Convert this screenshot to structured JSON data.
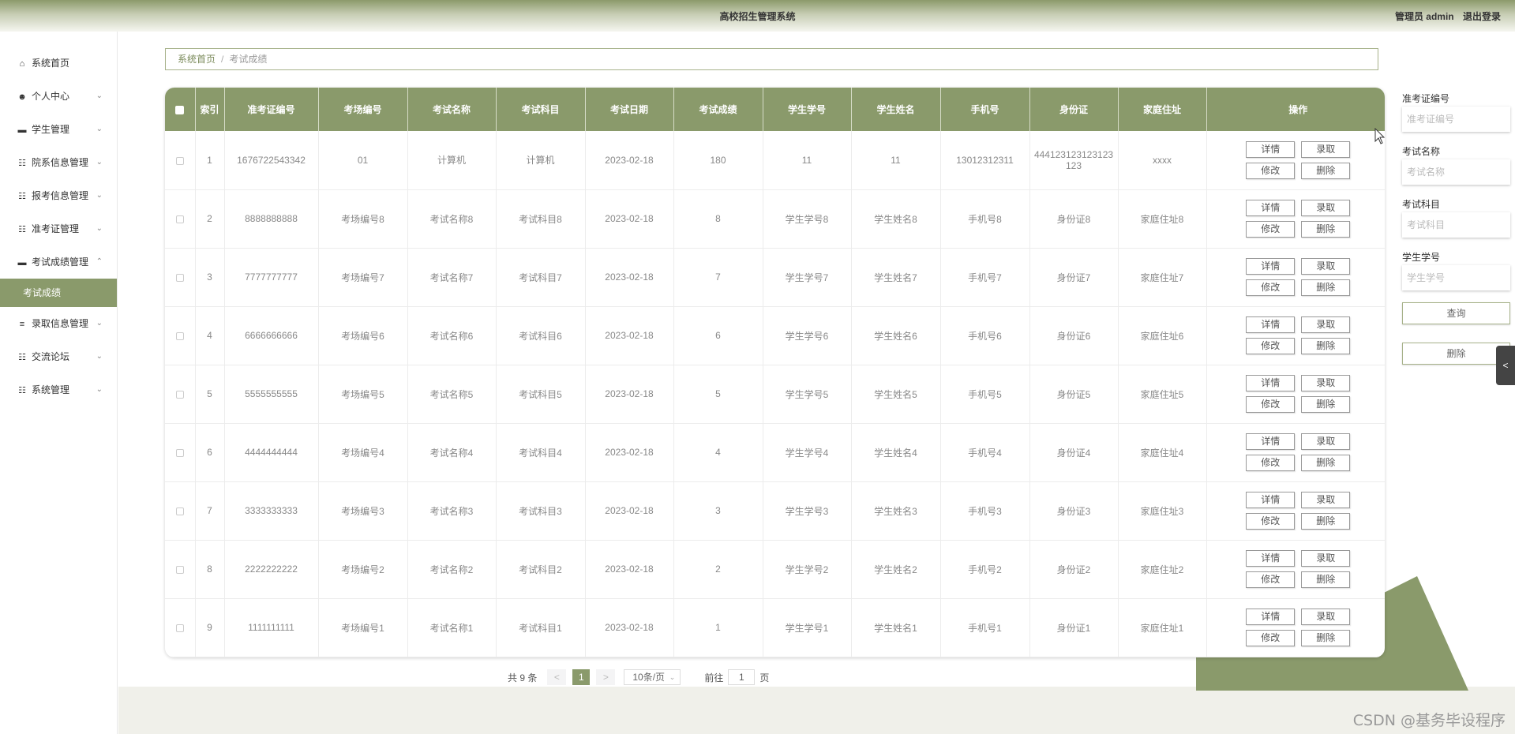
{
  "header": {
    "title": "高校招生管理系统",
    "user": "管理员 admin",
    "logout": "退出登录"
  },
  "sidebar": {
    "items": [
      {
        "label": "系统首页",
        "icon": "home-icon",
        "chevron": ""
      },
      {
        "label": "个人中心",
        "icon": "user-icon",
        "chevron": "down"
      },
      {
        "label": "学生管理",
        "icon": "briefcase-icon",
        "chevron": "down"
      },
      {
        "label": "院系信息管理",
        "icon": "grid-icon",
        "chevron": "down"
      },
      {
        "label": "报考信息管理",
        "icon": "grid-icon",
        "chevron": "down"
      },
      {
        "label": "准考证管理",
        "icon": "grid-icon",
        "chevron": "down"
      },
      {
        "label": "考试成绩管理",
        "icon": "monitor-icon",
        "chevron": "up"
      },
      {
        "label": "录取信息管理",
        "icon": "list-icon",
        "chevron": "down"
      },
      {
        "label": "交流论坛",
        "icon": "grid-icon",
        "chevron": "down"
      },
      {
        "label": "系统管理",
        "icon": "grid-icon",
        "chevron": "down"
      }
    ],
    "active_sub": "考试成绩"
  },
  "breadcrumb": {
    "home": "系统首页",
    "separator": "/",
    "current": "考试成绩"
  },
  "table": {
    "headers": [
      "索引",
      "准考证编号",
      "考场编号",
      "考试名称",
      "考试科目",
      "考试日期",
      "考试成绩",
      "学生学号",
      "学生姓名",
      "手机号",
      "身份证",
      "家庭住址",
      "操作"
    ],
    "rows": [
      [
        "1",
        "1676722543342",
        "01",
        "计算机",
        "计算机",
        "2023-02-18",
        "180",
        "11",
        "11",
        "13012312311",
        "444123123123123123",
        "xxxx"
      ],
      [
        "2",
        "8888888888",
        "考场编号8",
        "考试名称8",
        "考试科目8",
        "2023-02-18",
        "8",
        "学生学号8",
        "学生姓名8",
        "手机号8",
        "身份证8",
        "家庭住址8"
      ],
      [
        "3",
        "7777777777",
        "考场编号7",
        "考试名称7",
        "考试科目7",
        "2023-02-18",
        "7",
        "学生学号7",
        "学生姓名7",
        "手机号7",
        "身份证7",
        "家庭住址7"
      ],
      [
        "4",
        "6666666666",
        "考场编号6",
        "考试名称6",
        "考试科目6",
        "2023-02-18",
        "6",
        "学生学号6",
        "学生姓名6",
        "手机号6",
        "身份证6",
        "家庭住址6"
      ],
      [
        "5",
        "5555555555",
        "考场编号5",
        "考试名称5",
        "考试科目5",
        "2023-02-18",
        "5",
        "学生学号5",
        "学生姓名5",
        "手机号5",
        "身份证5",
        "家庭住址5"
      ],
      [
        "6",
        "4444444444",
        "考场编号4",
        "考试名称4",
        "考试科目4",
        "2023-02-18",
        "4",
        "学生学号4",
        "学生姓名4",
        "手机号4",
        "身份证4",
        "家庭住址4"
      ],
      [
        "7",
        "3333333333",
        "考场编号3",
        "考试名称3",
        "考试科目3",
        "2023-02-18",
        "3",
        "学生学号3",
        "学生姓名3",
        "手机号3",
        "身份证3",
        "家庭住址3"
      ],
      [
        "8",
        "2222222222",
        "考场编号2",
        "考试名称2",
        "考试科目2",
        "2023-02-18",
        "2",
        "学生学号2",
        "学生姓名2",
        "手机号2",
        "身份证2",
        "家庭住址2"
      ],
      [
        "9",
        "1111111111",
        "考场编号1",
        "考试名称1",
        "考试科目1",
        "2023-02-18",
        "1",
        "学生学号1",
        "学生姓名1",
        "手机号1",
        "身份证1",
        "家庭住址1"
      ]
    ],
    "actions": {
      "detail": "详情",
      "admit": "录取",
      "edit": "修改",
      "delete": "删除"
    }
  },
  "pagination": {
    "total": "共 9 条",
    "prev": "<",
    "page": "1",
    "next": ">",
    "page_size": "10条/页",
    "goto": "前往",
    "goto_value": "1",
    "page_unit": "页"
  },
  "search": {
    "fields": [
      {
        "label": "准考证编号",
        "placeholder": "准考证编号"
      },
      {
        "label": "考试名称",
        "placeholder": "考试名称"
      },
      {
        "label": "考试科目",
        "placeholder": "考试科目"
      },
      {
        "label": "学生学号",
        "placeholder": "学生学号"
      }
    ],
    "query_label": "查询",
    "delete_label": "删除"
  },
  "side_tab": "<",
  "watermark": "CSDN @基务毕设程序",
  "colors": {
    "accent": "#8a9a6b",
    "header_dark": "#8c9a6a",
    "border": "#a7b28a"
  }
}
